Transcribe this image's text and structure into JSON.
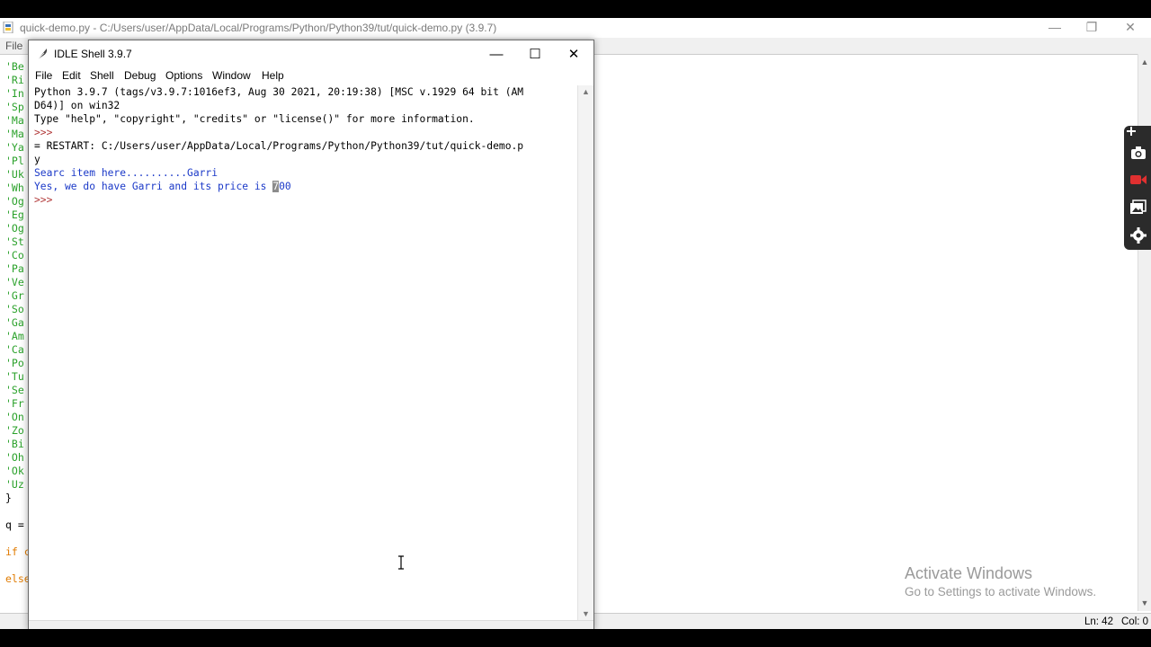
{
  "editor": {
    "title": "quick-demo.py - C:/Users/user/AppData/Local/Programs/Python/Python39/tut/quick-demo.py (3.9.7)",
    "menu_file": "File",
    "visible_lines": [
      {
        "text": "'Be",
        "kind": "str"
      },
      {
        "text": "'Ri",
        "kind": "str"
      },
      {
        "text": "'In",
        "kind": "str"
      },
      {
        "text": "'Sp",
        "kind": "str"
      },
      {
        "text": "'Ma",
        "kind": "str"
      },
      {
        "text": "'Ma",
        "kind": "str"
      },
      {
        "text": "'Ya",
        "kind": "str"
      },
      {
        "text": "'Pl",
        "kind": "str"
      },
      {
        "text": "'Uk",
        "kind": "str"
      },
      {
        "text": "'Wh",
        "kind": "str"
      },
      {
        "text": "'Og",
        "kind": "str"
      },
      {
        "text": "'Eg",
        "kind": "str"
      },
      {
        "text": "'Og",
        "kind": "str"
      },
      {
        "text": "'St",
        "kind": "str"
      },
      {
        "text": "'Co",
        "kind": "str"
      },
      {
        "text": "'Pa",
        "kind": "str"
      },
      {
        "text": "'Ve",
        "kind": "str"
      },
      {
        "text": "'Gr",
        "kind": "str"
      },
      {
        "text": "'So",
        "kind": "str"
      },
      {
        "text": "'Ga",
        "kind": "str"
      },
      {
        "text": "'Am",
        "kind": "str"
      },
      {
        "text": "'Ca",
        "kind": "str"
      },
      {
        "text": "'Po",
        "kind": "str"
      },
      {
        "text": "'Tu",
        "kind": "str"
      },
      {
        "text": "'Se",
        "kind": "str"
      },
      {
        "text": "'Fr",
        "kind": "str"
      },
      {
        "text": "'On",
        "kind": "str"
      },
      {
        "text": "'Zo",
        "kind": "str"
      },
      {
        "text": "'Bi",
        "kind": "str"
      },
      {
        "text": "'Oh",
        "kind": "str"
      },
      {
        "text": "'Ok",
        "kind": "str"
      },
      {
        "text": "'Uz",
        "kind": "str"
      },
      {
        "text": "}",
        "kind": "plain"
      },
      {
        "text": "",
        "kind": "plain"
      },
      {
        "text": "q =",
        "kind": "plain"
      },
      {
        "text": "",
        "kind": "plain"
      },
      {
        "text": "if c",
        "kind": "kw"
      },
      {
        "text": "",
        "kind": "plain"
      },
      {
        "text": "else",
        "kind": "kw"
      }
    ],
    "status_ln": "Ln: 42",
    "status_col": "Col: 0"
  },
  "watermark": {
    "line1": "Activate Windows",
    "line2": "Go to Settings to activate Windows."
  },
  "shell": {
    "title": "IDLE Shell 3.9.7",
    "menu": [
      "File",
      "Edit",
      "Shell",
      "Debug",
      "Options",
      "Window",
      "Help"
    ],
    "lines": {
      "l1": "Python 3.9.7 (tags/v3.9.7:1016ef3, Aug 30 2021, 20:19:38) [MSC v.1929 64 bit (AM",
      "l2": "D64)] on win32",
      "l3": "Type \"help\", \"copyright\", \"credits\" or \"license()\" for more information.",
      "l4": ">>>",
      "l5": "= RESTART: C:/Users/user/AppData/Local/Programs/Python/Python39/tut/quick-demo.p",
      "l6": "y",
      "l7": "Searc item here..........Garri",
      "l8_pre": "Yes, we do have Garri and its price is ",
      "l8_sel": "7",
      "l8_post": "00",
      "l9": ">>>"
    }
  },
  "icons": {
    "recorder": [
      "plus-icon",
      "camera-icon",
      "video-icon",
      "gallery-icon",
      "settings-icon"
    ]
  }
}
